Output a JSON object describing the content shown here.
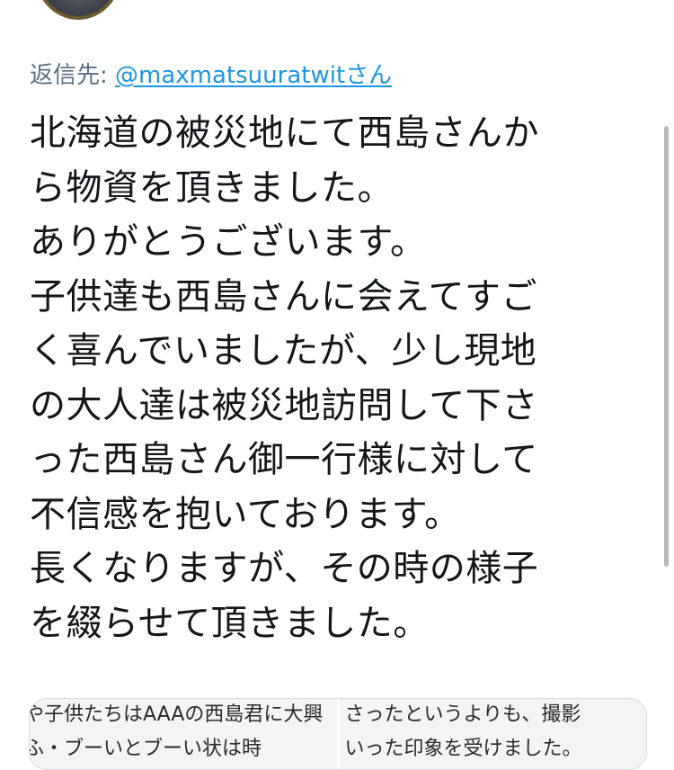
{
  "reply": {
    "prefix": "返信先: ",
    "handle": "@maxmatsuuratwitさん"
  },
  "tweet": {
    "lines": [
      "北海道の被災地にて西島さんか",
      "ら物資を頂きました。",
      "ありがとうございます。",
      "子供達も西島さんに会えてすご",
      "く喜んでいましたが、少し現地",
      "の大人達は被災地訪問して下さ",
      "った西島さん御一行様に対して",
      "不信感を抱いております。",
      "長くなりますが、その時の様子",
      "を綴らせて頂きました。"
    ]
  },
  "media": {
    "left": {
      "line1": "や子供たちはAAAの西島君に大興",
      "line2": "ふ・ブーいとブーい状は時"
    },
    "right": {
      "line1": "さったというよりも、撮影",
      "line2": "いった印象を受けました。"
    }
  }
}
